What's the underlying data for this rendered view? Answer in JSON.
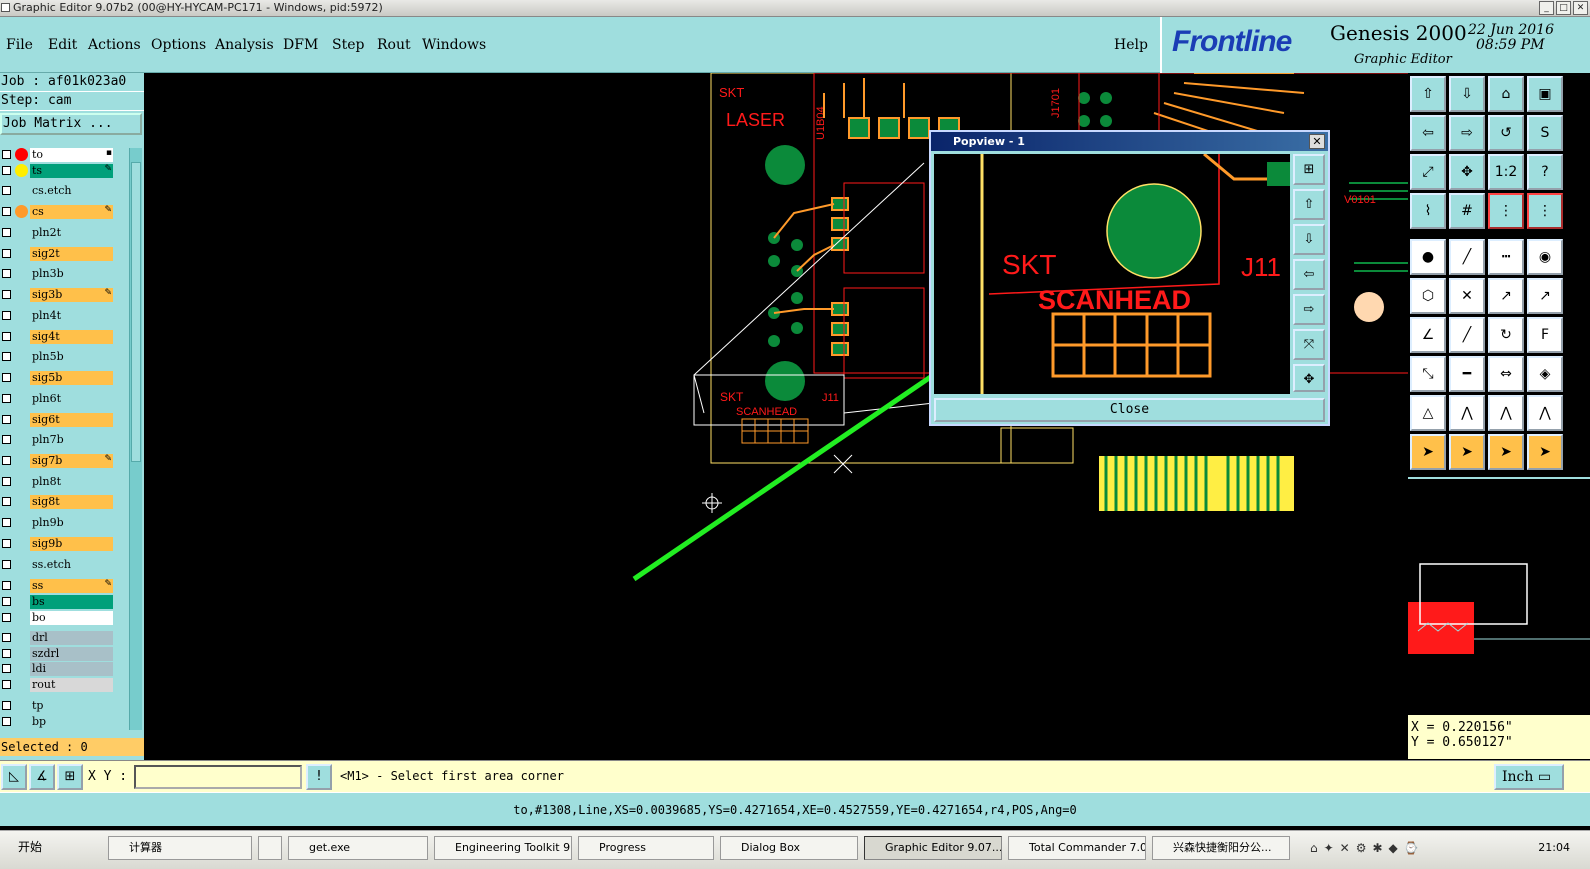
{
  "window": {
    "title": "Graphic Editor 9.07b2 (00@HY-HYCAM-PC171 - Windows, pid:5972)"
  },
  "menu": [
    {
      "label": "File"
    },
    {
      "label": "Edit"
    },
    {
      "label": "Actions"
    },
    {
      "label": "Options"
    },
    {
      "label": "Analysis"
    },
    {
      "label": "DFM"
    },
    {
      "label": "Step"
    },
    {
      "label": "Rout"
    },
    {
      "label": "Windows"
    },
    {
      "label": "Help"
    }
  ],
  "brand": {
    "logo": "Frontline",
    "product": "Genesis 2000",
    "subtitle": "Graphic Editor",
    "date": "22 Jun 2016",
    "time": "08:59 PM"
  },
  "job": {
    "job_label": "Job : af01k023a0",
    "step_label": "Step: cam",
    "matrix_button": "Job Matrix ..."
  },
  "layers": [
    {
      "name": "to",
      "bg": "#ffffff",
      "dot": "#ff0000",
      "mark": "▪"
    },
    {
      "name": "ts",
      "bg": "#00a07a",
      "dot": "#ffee00",
      "mark": "✎"
    },
    {
      "name": "cs.etch",
      "bg": "#9fdede",
      "dot": "",
      "mark": ""
    },
    {
      "name": "cs",
      "bg": "#ffc04a",
      "dot": "#ff9a2a",
      "mark": "✎"
    },
    {
      "name": "pln2t",
      "bg": "#9fdede",
      "dot": "",
      "mark": ""
    },
    {
      "name": "sig2t",
      "bg": "#ffc04a",
      "dot": "",
      "mark": ""
    },
    {
      "name": "pln3b",
      "bg": "#9fdede",
      "dot": "",
      "mark": ""
    },
    {
      "name": "sig3b",
      "bg": "#ffc04a",
      "dot": "",
      "mark": "✎"
    },
    {
      "name": "pln4t",
      "bg": "#9fdede",
      "dot": "",
      "mark": ""
    },
    {
      "name": "sig4t",
      "bg": "#ffc04a",
      "dot": "",
      "mark": ""
    },
    {
      "name": "pln5b",
      "bg": "#9fdede",
      "dot": "",
      "mark": ""
    },
    {
      "name": "sig5b",
      "bg": "#ffc04a",
      "dot": "",
      "mark": ""
    },
    {
      "name": "pln6t",
      "bg": "#9fdede",
      "dot": "",
      "mark": ""
    },
    {
      "name": "sig6t",
      "bg": "#ffc04a",
      "dot": "",
      "mark": ""
    },
    {
      "name": "pln7b",
      "bg": "#9fdede",
      "dot": "",
      "mark": ""
    },
    {
      "name": "sig7b",
      "bg": "#ffc04a",
      "dot": "",
      "mark": "✎"
    },
    {
      "name": "pln8t",
      "bg": "#9fdede",
      "dot": "",
      "mark": ""
    },
    {
      "name": "sig8t",
      "bg": "#ffc04a",
      "dot": "",
      "mark": ""
    },
    {
      "name": "pln9b",
      "bg": "#9fdede",
      "dot": "",
      "mark": ""
    },
    {
      "name": "sig9b",
      "bg": "#ffc04a",
      "dot": "",
      "mark": ""
    },
    {
      "name": "ss.etch",
      "bg": "#9fdede",
      "dot": "",
      "mark": ""
    },
    {
      "name": "ss",
      "bg": "#ffc04a",
      "dot": "",
      "mark": "✎"
    },
    {
      "name": "bs",
      "bg": "#00a07a",
      "dot": "",
      "mark": ""
    },
    {
      "name": "bo",
      "bg": "#ffffff",
      "dot": "",
      "mark": ""
    },
    {
      "name": "drl",
      "bg": "#a8c0c8",
      "dot": "",
      "mark": ""
    },
    {
      "name": "szdrl",
      "bg": "#a8c0c8",
      "dot": "",
      "mark": ""
    },
    {
      "name": "ldi",
      "bg": "#a8c0c8",
      "dot": "",
      "mark": ""
    },
    {
      "name": "rout",
      "bg": "#d8d8d8",
      "dot": "",
      "mark": ""
    },
    {
      "name": "tp",
      "bg": "#9fdede",
      "dot": "",
      "mark": ""
    },
    {
      "name": "bp",
      "bg": "#9fdede",
      "dot": "",
      "mark": ""
    }
  ],
  "selected": "Selected : 0",
  "canvas_labels": {
    "skt": "SKT",
    "laser": "LASER",
    "j11": "J11",
    "scanhead": "SCANHEAD",
    "u1b04": "U1B04",
    "j1701": "J1701",
    "v0101": "V0101"
  },
  "popview": {
    "title": "Popview - 1",
    "close": "Close",
    "skt": "SKT",
    "j11": "J11",
    "scanhead": "SCANHEAD"
  },
  "coords": {
    "x": "X = 0.220156\"",
    "y": "Y = 0.650127\""
  },
  "command": {
    "xy_label": "X Y :",
    "xy_value": "",
    "message": "<M1> - Select first area corner",
    "unit": "Inch"
  },
  "status_line": "to,#1308,Line,XS=0.0039685,YS=0.4271654,XE=0.4527559,YE=0.4271654,r4,POS,Ang=0",
  "taskbar": {
    "start": "开始",
    "items": [
      {
        "label": "计算器",
        "active": false
      },
      {
        "label": "",
        "active": false
      },
      {
        "label": "get.exe",
        "active": false
      },
      {
        "label": "Engineering Toolkit 9....",
        "active": false
      },
      {
        "label": "Progress",
        "active": false
      },
      {
        "label": "Dialog Box",
        "active": false
      },
      {
        "label": "Graphic Editor 9.07...",
        "active": true
      },
      {
        "label": "Total Commander 7.0...",
        "active": false
      },
      {
        "label": "兴森快捷衡阳分公...",
        "active": false
      }
    ],
    "clock": "21:04"
  },
  "colors": {
    "accent": "#9fdede",
    "red": "#ff1a1a",
    "orange": "#ff9a2a",
    "green_pad": "#0b8a3a",
    "arrow": "#22ee22"
  }
}
